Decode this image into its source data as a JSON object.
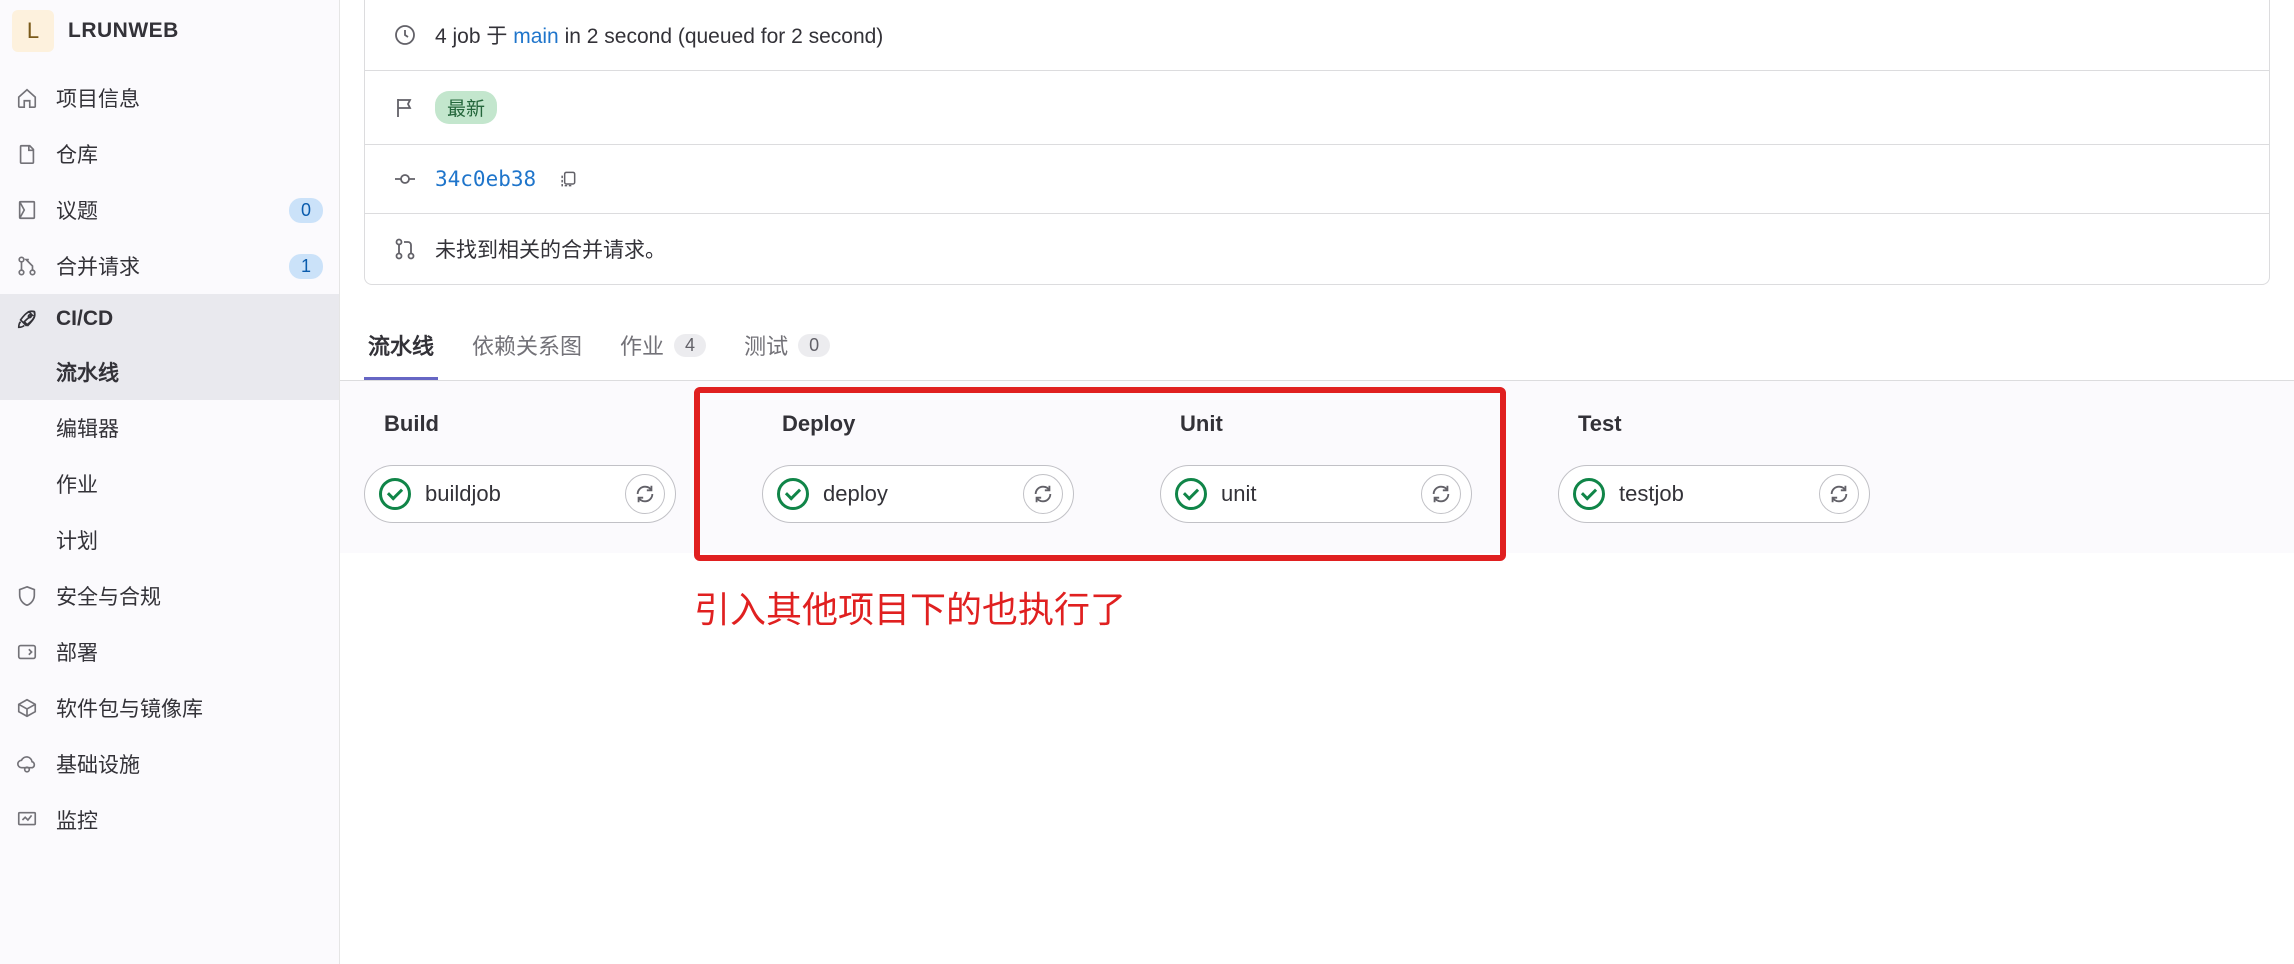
{
  "project": {
    "avatar_letter": "L",
    "name": "LRUNWEB"
  },
  "sidebar": {
    "items": [
      {
        "label": "项目信息"
      },
      {
        "label": "仓库"
      },
      {
        "label": "议题",
        "badge": "0"
      },
      {
        "label": "合并请求",
        "badge": "1"
      },
      {
        "label": "CI/CD"
      },
      {
        "label": "安全与合规"
      },
      {
        "label": "部署"
      },
      {
        "label": "软件包与镜像库"
      },
      {
        "label": "基础设施"
      },
      {
        "label": "监控"
      }
    ],
    "cicd_sub": [
      {
        "label": "流水线"
      },
      {
        "label": "编辑器"
      },
      {
        "label": "作业"
      },
      {
        "label": "计划"
      }
    ]
  },
  "info": {
    "jobs_prefix": "4 job 于 ",
    "branch": "main",
    "jobs_suffix": " in 2 second (queued for 2 second)",
    "latest_label": "最新",
    "commit_sha": "34c0eb38",
    "mr_text": "未找到相关的合并请求。"
  },
  "tabs": [
    {
      "label": "流水线",
      "count": null
    },
    {
      "label": "依赖关系图",
      "count": null
    },
    {
      "label": "作业",
      "count": "4"
    },
    {
      "label": "测试",
      "count": "0"
    }
  ],
  "stages": [
    {
      "name": "Build",
      "job": "buildjob"
    },
    {
      "name": "Deploy",
      "job": "deploy"
    },
    {
      "name": "Unit",
      "job": "unit"
    },
    {
      "name": "Test",
      "job": "testjob"
    }
  ],
  "annotation": "引入其他项目下的也执行了"
}
